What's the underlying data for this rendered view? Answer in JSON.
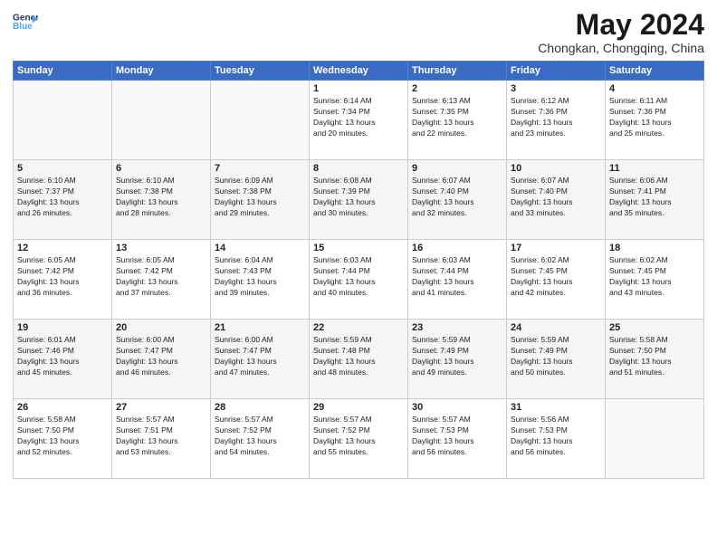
{
  "header": {
    "title": "May 2024",
    "location": "Chongkan, Chongqing, China"
  },
  "calendar": {
    "headers": [
      "Sunday",
      "Monday",
      "Tuesday",
      "Wednesday",
      "Thursday",
      "Friday",
      "Saturday"
    ],
    "weeks": [
      [
        {
          "day": "",
          "info": ""
        },
        {
          "day": "",
          "info": ""
        },
        {
          "day": "",
          "info": ""
        },
        {
          "day": "1",
          "info": "Sunrise: 6:14 AM\nSunset: 7:34 PM\nDaylight: 13 hours\nand 20 minutes."
        },
        {
          "day": "2",
          "info": "Sunrise: 6:13 AM\nSunset: 7:35 PM\nDaylight: 13 hours\nand 22 minutes."
        },
        {
          "day": "3",
          "info": "Sunrise: 6:12 AM\nSunset: 7:36 PM\nDaylight: 13 hours\nand 23 minutes."
        },
        {
          "day": "4",
          "info": "Sunrise: 6:11 AM\nSunset: 7:36 PM\nDaylight: 13 hours\nand 25 minutes."
        }
      ],
      [
        {
          "day": "5",
          "info": "Sunrise: 6:10 AM\nSunset: 7:37 PM\nDaylight: 13 hours\nand 26 minutes."
        },
        {
          "day": "6",
          "info": "Sunrise: 6:10 AM\nSunset: 7:38 PM\nDaylight: 13 hours\nand 28 minutes."
        },
        {
          "day": "7",
          "info": "Sunrise: 6:09 AM\nSunset: 7:38 PM\nDaylight: 13 hours\nand 29 minutes."
        },
        {
          "day": "8",
          "info": "Sunrise: 6:08 AM\nSunset: 7:39 PM\nDaylight: 13 hours\nand 30 minutes."
        },
        {
          "day": "9",
          "info": "Sunrise: 6:07 AM\nSunset: 7:40 PM\nDaylight: 13 hours\nand 32 minutes."
        },
        {
          "day": "10",
          "info": "Sunrise: 6:07 AM\nSunset: 7:40 PM\nDaylight: 13 hours\nand 33 minutes."
        },
        {
          "day": "11",
          "info": "Sunrise: 6:06 AM\nSunset: 7:41 PM\nDaylight: 13 hours\nand 35 minutes."
        }
      ],
      [
        {
          "day": "12",
          "info": "Sunrise: 6:05 AM\nSunset: 7:42 PM\nDaylight: 13 hours\nand 36 minutes."
        },
        {
          "day": "13",
          "info": "Sunrise: 6:05 AM\nSunset: 7:42 PM\nDaylight: 13 hours\nand 37 minutes."
        },
        {
          "day": "14",
          "info": "Sunrise: 6:04 AM\nSunset: 7:43 PM\nDaylight: 13 hours\nand 39 minutes."
        },
        {
          "day": "15",
          "info": "Sunrise: 6:03 AM\nSunset: 7:44 PM\nDaylight: 13 hours\nand 40 minutes."
        },
        {
          "day": "16",
          "info": "Sunrise: 6:03 AM\nSunset: 7:44 PM\nDaylight: 13 hours\nand 41 minutes."
        },
        {
          "day": "17",
          "info": "Sunrise: 6:02 AM\nSunset: 7:45 PM\nDaylight: 13 hours\nand 42 minutes."
        },
        {
          "day": "18",
          "info": "Sunrise: 6:02 AM\nSunset: 7:45 PM\nDaylight: 13 hours\nand 43 minutes."
        }
      ],
      [
        {
          "day": "19",
          "info": "Sunrise: 6:01 AM\nSunset: 7:46 PM\nDaylight: 13 hours\nand 45 minutes."
        },
        {
          "day": "20",
          "info": "Sunrise: 6:00 AM\nSunset: 7:47 PM\nDaylight: 13 hours\nand 46 minutes."
        },
        {
          "day": "21",
          "info": "Sunrise: 6:00 AM\nSunset: 7:47 PM\nDaylight: 13 hours\nand 47 minutes."
        },
        {
          "day": "22",
          "info": "Sunrise: 5:59 AM\nSunset: 7:48 PM\nDaylight: 13 hours\nand 48 minutes."
        },
        {
          "day": "23",
          "info": "Sunrise: 5:59 AM\nSunset: 7:49 PM\nDaylight: 13 hours\nand 49 minutes."
        },
        {
          "day": "24",
          "info": "Sunrise: 5:59 AM\nSunset: 7:49 PM\nDaylight: 13 hours\nand 50 minutes."
        },
        {
          "day": "25",
          "info": "Sunrise: 5:58 AM\nSunset: 7:50 PM\nDaylight: 13 hours\nand 51 minutes."
        }
      ],
      [
        {
          "day": "26",
          "info": "Sunrise: 5:58 AM\nSunset: 7:50 PM\nDaylight: 13 hours\nand 52 minutes."
        },
        {
          "day": "27",
          "info": "Sunrise: 5:57 AM\nSunset: 7:51 PM\nDaylight: 13 hours\nand 53 minutes."
        },
        {
          "day": "28",
          "info": "Sunrise: 5:57 AM\nSunset: 7:52 PM\nDaylight: 13 hours\nand 54 minutes."
        },
        {
          "day": "29",
          "info": "Sunrise: 5:57 AM\nSunset: 7:52 PM\nDaylight: 13 hours\nand 55 minutes."
        },
        {
          "day": "30",
          "info": "Sunrise: 5:57 AM\nSunset: 7:53 PM\nDaylight: 13 hours\nand 56 minutes."
        },
        {
          "day": "31",
          "info": "Sunrise: 5:56 AM\nSunset: 7:53 PM\nDaylight: 13 hours\nand 56 minutes."
        },
        {
          "day": "",
          "info": ""
        }
      ]
    ]
  }
}
